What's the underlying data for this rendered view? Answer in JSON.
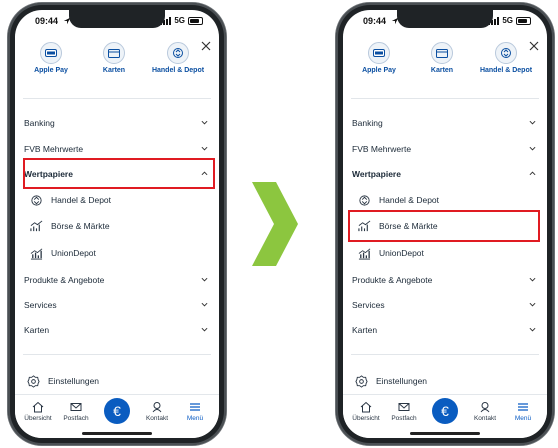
{
  "status": {
    "time": "09:44",
    "network": "5G"
  },
  "quick_actions": [
    "Apple Pay",
    "Karten",
    "Handel & Depot"
  ],
  "menu": {
    "banking": "Banking",
    "mehrwerte": "FVB Mehrwerte",
    "wertpapiere": "Wertpapiere",
    "sub_items": [
      "Handel & Depot",
      "Börse & Märkte",
      "UnionDepot"
    ],
    "produkte": "Produkte & Angebote",
    "services": "Services",
    "karten": "Karten",
    "einstellungen": "Einstellungen"
  },
  "tabs": {
    "uebersicht": "Übersicht",
    "postfach": "Postfach",
    "euro": "€",
    "kontakt": "Kontakt",
    "menu": "Menü"
  },
  "colors": {
    "accent": "#0a5cc0",
    "highlight": "#e01b22",
    "arrow": "#8cc63f"
  }
}
